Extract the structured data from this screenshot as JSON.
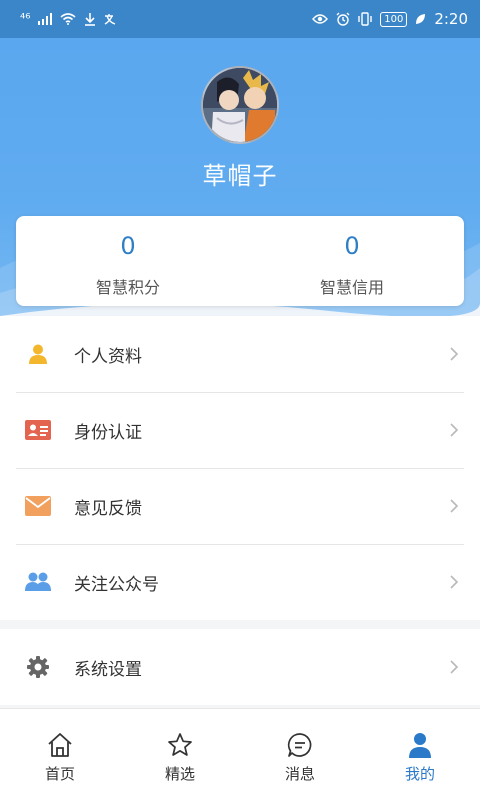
{
  "status_bar": {
    "network": "⁴⁶",
    "time": "2:20",
    "battery": "100"
  },
  "profile": {
    "username": "草帽子"
  },
  "scores": [
    {
      "value": "0",
      "label": "智慧积分"
    },
    {
      "value": "0",
      "label": "智慧信用"
    }
  ],
  "menu": [
    {
      "label": "个人资料",
      "icon": "user-icon"
    },
    {
      "label": "身份认证",
      "icon": "id-card-icon"
    },
    {
      "label": "意见反馈",
      "icon": "mail-icon"
    },
    {
      "label": "关注公众号",
      "icon": "group-icon"
    }
  ],
  "settings": {
    "label": "系统设置",
    "icon": "gear-icon"
  },
  "tabs": [
    {
      "label": "首页",
      "icon": "home-icon"
    },
    {
      "label": "精选",
      "icon": "star-icon"
    },
    {
      "label": "消息",
      "icon": "message-icon"
    },
    {
      "label": "我的",
      "icon": "user-icon",
      "active": true
    }
  ],
  "colors": {
    "header": "#5aa7ef",
    "status_bar": "#3b86c9",
    "accent": "#2b79c9",
    "score": "#2f7fc7"
  }
}
